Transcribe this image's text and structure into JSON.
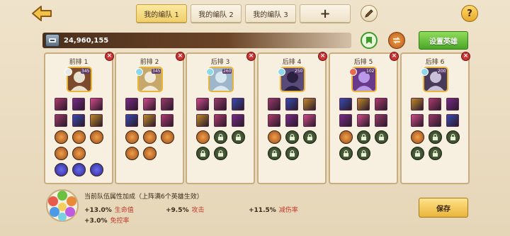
{
  "header": {
    "tabs": [
      {
        "label": "我的编队 1",
        "active": true
      },
      {
        "label": "我的编队 2",
        "active": false
      },
      {
        "label": "我的编队 3",
        "active": false
      }
    ],
    "add_label": "+",
    "help_label": "?"
  },
  "power": {
    "value": "24,960,155",
    "set_hero_label": "设置英雄"
  },
  "slots": [
    {
      "title": "前排 1",
      "level": "345",
      "element_color": "#e8e8e8",
      "hero_colors": [
        "#e8e0d0",
        "#7a4a2a"
      ]
    },
    {
      "title": "前排 2",
      "level": "345",
      "element_color": "#8fd8e8",
      "hero_colors": [
        "#f2ead8",
        "#c6a86a"
      ]
    },
    {
      "title": "后排 3",
      "level": "260",
      "element_color": "#8fd8e8",
      "hero_colors": [
        "#d8e8f0",
        "#9fb6c8"
      ]
    },
    {
      "title": "后排 4",
      "level": "250",
      "element_color": "#8fd8e8",
      "hero_colors": [
        "#2a2040",
        "#5a4a7a"
      ]
    },
    {
      "title": "后排 5",
      "level": "102",
      "element_color": "#e86a4a",
      "hero_colors": [
        "#b89ae8",
        "#6a3a8a"
      ]
    },
    {
      "title": "后排 6",
      "level": "200",
      "element_color": "#8fd8e8",
      "hero_colors": [
        "#c8c0d8",
        "#4a3a5a"
      ]
    }
  ],
  "bonus": {
    "title": "当前队伍属性加成（上阵满6个英雄生效）",
    "stats": [
      {
        "value": "+13.0%",
        "name": "生命值"
      },
      {
        "value": "+9.5%",
        "name": "攻击"
      },
      {
        "value": "+11.5%",
        "name": "减伤率"
      },
      {
        "value": "+3.0%",
        "name": "免控率"
      }
    ]
  },
  "footer": {
    "save_label": "保存"
  },
  "colors": {
    "accent_green": "#4aa628",
    "accent_gold": "#e9b53a",
    "stat_red": "#c0392b"
  }
}
